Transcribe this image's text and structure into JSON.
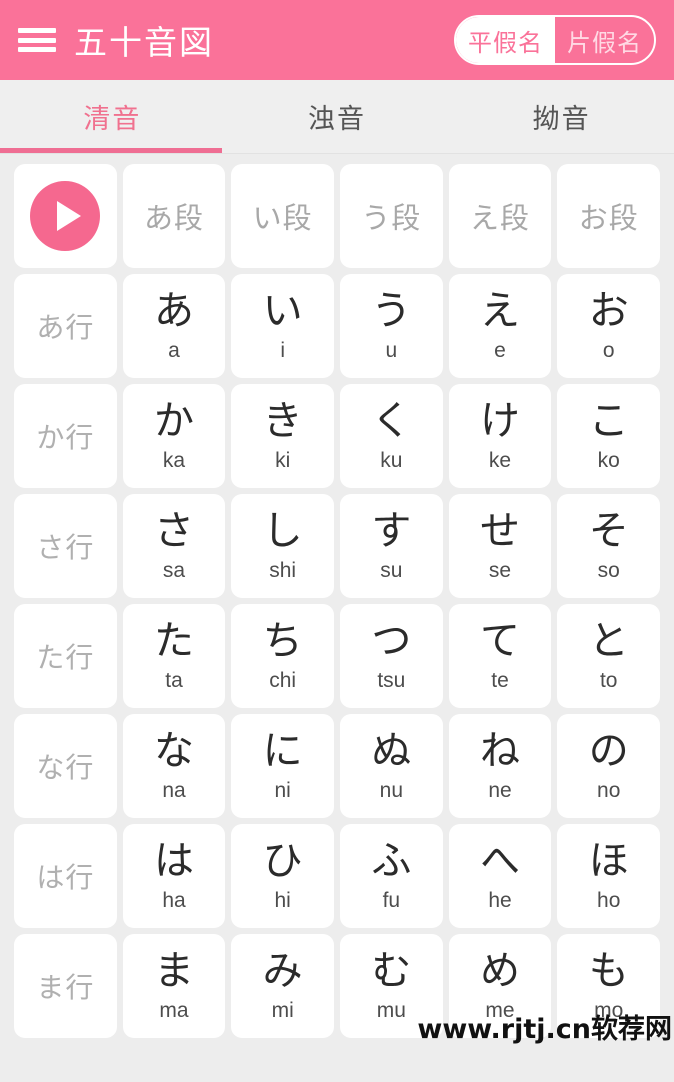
{
  "header": {
    "title": "五十音図",
    "menu_icon": "hamburger-menu-icon",
    "toggle": {
      "hiragana_label": "平假名",
      "katakana_label": "片假名",
      "selected": "平假名"
    }
  },
  "tabs": [
    {
      "label": "清音",
      "active": true
    },
    {
      "label": "浊音",
      "active": false
    },
    {
      "label": "拗音",
      "active": false
    }
  ],
  "grid": {
    "column_headers": [
      "あ段",
      "い段",
      "う段",
      "え段",
      "お段"
    ],
    "play_button": "play-icon",
    "rows": [
      {
        "row_label": "あ行",
        "cells": [
          {
            "kana": "あ",
            "romaji": "a"
          },
          {
            "kana": "い",
            "romaji": "i"
          },
          {
            "kana": "う",
            "romaji": "u"
          },
          {
            "kana": "え",
            "romaji": "e"
          },
          {
            "kana": "お",
            "romaji": "o"
          }
        ]
      },
      {
        "row_label": "か行",
        "cells": [
          {
            "kana": "か",
            "romaji": "ka"
          },
          {
            "kana": "き",
            "romaji": "ki"
          },
          {
            "kana": "く",
            "romaji": "ku"
          },
          {
            "kana": "け",
            "romaji": "ke"
          },
          {
            "kana": "こ",
            "romaji": "ko"
          }
        ]
      },
      {
        "row_label": "さ行",
        "cells": [
          {
            "kana": "さ",
            "romaji": "sa"
          },
          {
            "kana": "し",
            "romaji": "shi"
          },
          {
            "kana": "す",
            "romaji": "su"
          },
          {
            "kana": "せ",
            "romaji": "se"
          },
          {
            "kana": "そ",
            "romaji": "so"
          }
        ]
      },
      {
        "row_label": "た行",
        "cells": [
          {
            "kana": "た",
            "romaji": "ta"
          },
          {
            "kana": "ち",
            "romaji": "chi"
          },
          {
            "kana": "つ",
            "romaji": "tsu"
          },
          {
            "kana": "て",
            "romaji": "te"
          },
          {
            "kana": "と",
            "romaji": "to"
          }
        ]
      },
      {
        "row_label": "な行",
        "cells": [
          {
            "kana": "な",
            "romaji": "na"
          },
          {
            "kana": "に",
            "romaji": "ni"
          },
          {
            "kana": "ぬ",
            "romaji": "nu"
          },
          {
            "kana": "ね",
            "romaji": "ne"
          },
          {
            "kana": "の",
            "romaji": "no"
          }
        ]
      },
      {
        "row_label": "は行",
        "cells": [
          {
            "kana": "は",
            "romaji": "ha"
          },
          {
            "kana": "ひ",
            "romaji": "hi"
          },
          {
            "kana": "ふ",
            "romaji": "fu"
          },
          {
            "kana": "へ",
            "romaji": "he"
          },
          {
            "kana": "ほ",
            "romaji": "ho"
          }
        ]
      },
      {
        "row_label": "ま行",
        "cells": [
          {
            "kana": "ま",
            "romaji": "ma"
          },
          {
            "kana": "み",
            "romaji": "mi"
          },
          {
            "kana": "む",
            "romaji": "mu"
          },
          {
            "kana": "め",
            "romaji": "me"
          },
          {
            "kana": "も",
            "romaji": "mo"
          }
        ]
      }
    ]
  },
  "watermark": {
    "text": "www.rjtj.cn软荐网"
  },
  "colors": {
    "brand_pink": "#fa7299",
    "accent_pink": "#f5688f",
    "tab_active": "#f0718f",
    "page_bg": "#ededed",
    "cell_bg": "#ffffff",
    "label_gray": "#b0b0b0",
    "kana_dark": "#2b2b2b"
  }
}
